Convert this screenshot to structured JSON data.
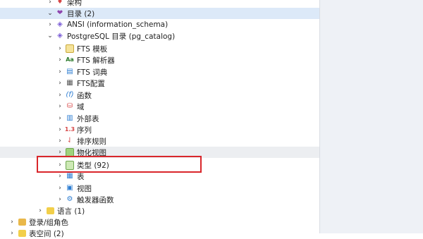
{
  "tree": {
    "items": [
      {
        "label": "架构",
        "icon": "schema-icon",
        "chev": "›"
      },
      {
        "label": "目录 (2)",
        "icon": "catalog-icon",
        "chev": "⌄"
      },
      {
        "label": "ANSI (information_schema)",
        "icon": "schema-diamond-icon",
        "chev": "›"
      },
      {
        "label": "PostgreSQL 目录 (pg_catalog)",
        "icon": "schema-diamond-icon",
        "chev": "⌄"
      },
      {
        "label": "FTS 模板",
        "icon": "fts-template-icon",
        "chev": "›"
      },
      {
        "label": "FTS 解析器",
        "icon": "fts-parser-icon",
        "chev": "›"
      },
      {
        "label": "FTS 词典",
        "icon": "fts-dictionary-icon",
        "chev": "›"
      },
      {
        "label": "FTS配置",
        "icon": "fts-config-icon",
        "chev": "›"
      },
      {
        "label": "函数",
        "icon": "function-icon",
        "chev": "›"
      },
      {
        "label": "域",
        "icon": "domain-icon",
        "chev": "›"
      },
      {
        "label": "外部表",
        "icon": "foreign-table-icon",
        "chev": "›"
      },
      {
        "label": "序列",
        "icon": "sequence-icon",
        "chev": "›"
      },
      {
        "label": "排序规则",
        "icon": "collation-icon",
        "chev": "›"
      },
      {
        "label": "物化视图",
        "icon": "materialized-view-icon",
        "chev": "›"
      },
      {
        "label": "类型 (92)",
        "icon": "type-icon",
        "chev": "›"
      },
      {
        "label": "表",
        "icon": "table-icon",
        "chev": "›"
      },
      {
        "label": "视图",
        "icon": "view-icon",
        "chev": "›"
      },
      {
        "label": "触发器函数",
        "icon": "trigger-function-icon",
        "chev": "›"
      },
      {
        "label": "语言 (1)",
        "icon": "language-icon",
        "chev": "›"
      },
      {
        "label": "登录/组角色",
        "icon": "login-role-icon",
        "chev": "›"
      },
      {
        "label": "表空间 (2)",
        "icon": "tablespace-icon",
        "chev": "›"
      }
    ]
  }
}
